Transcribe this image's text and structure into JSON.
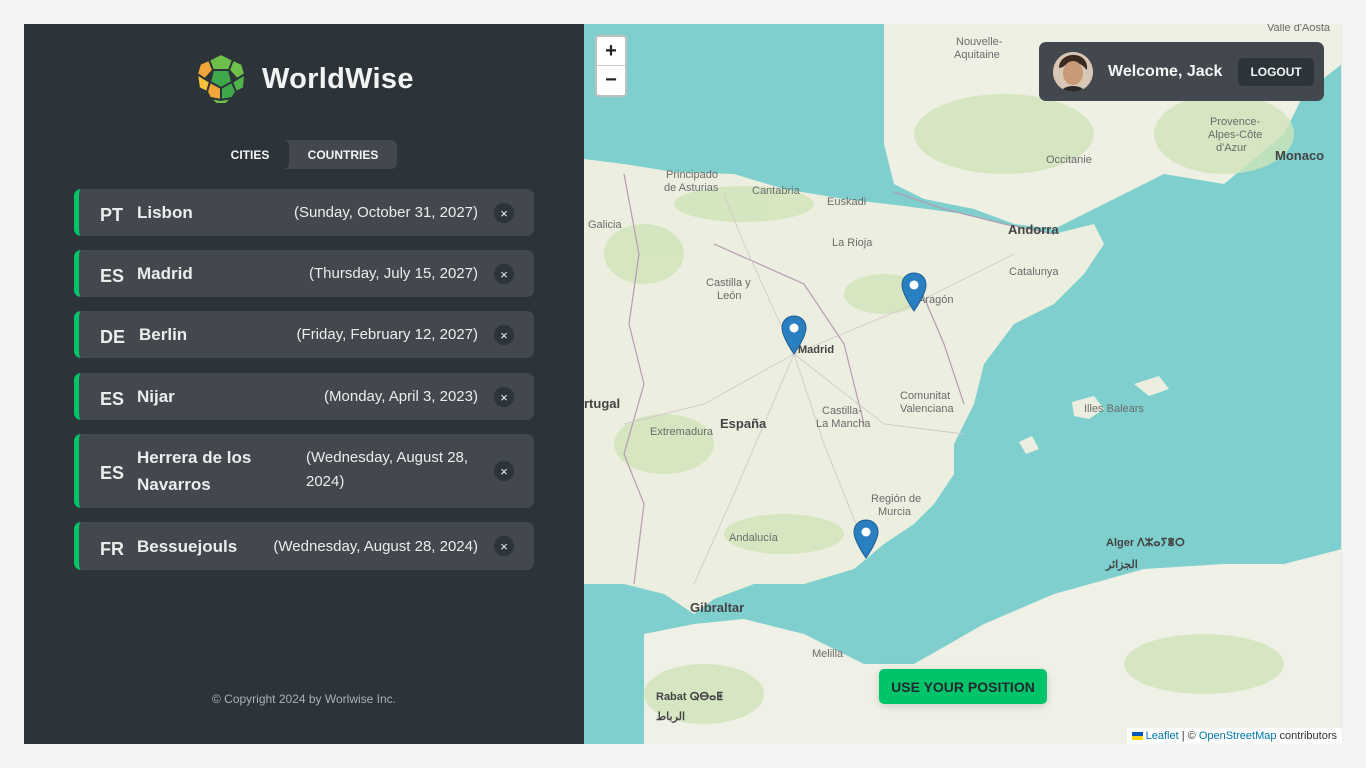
{
  "app": {
    "name": "WorldWise"
  },
  "tabs": {
    "cities": "CITIES",
    "countries": "COUNTRIES"
  },
  "cities": [
    {
      "code": "PT",
      "name": "Lisbon",
      "date": "(Sunday, October 31, 2027)"
    },
    {
      "code": "ES",
      "name": "Madrid",
      "date": "(Thursday, July 15, 2027)"
    },
    {
      "code": "DE",
      "name": "Berlin",
      "date": "(Friday, February 12, 2027)"
    },
    {
      "code": "ES",
      "name": "Nijar",
      "date": "(Monday, April 3, 2023)"
    },
    {
      "code": "ES",
      "name_line1": "Herrera de los",
      "name_line2": "Navarros",
      "date_line1": "(Wednesday, August 28,",
      "date_line2": "2024)"
    },
    {
      "code": "FR",
      "name": "Bessuejouls",
      "date": "(Wednesday, August 28, 2024)"
    }
  ],
  "delete_glyph": "×",
  "footer": "© Copyright 2024 by Worlwise Inc.",
  "map": {
    "zoom_in": "+",
    "zoom_out": "−",
    "labels": {
      "nouvelle": "Nouvelle-",
      "aquitaine": "Aquitaine",
      "valle": "Valle d'Aosta",
      "provence1": "Provence-",
      "provence2": "Alpes-Côte",
      "provence3": "d'Azur",
      "monaco": "Monaco",
      "occitanie": "Occitanie",
      "principado1": "Principado",
      "principado2": "de Asturias",
      "cantabria": "Cantabria",
      "euskadi": "Euskadi",
      "galicia": "Galicia",
      "larioja": "La Rioja",
      "andorra": "Andorra",
      "catalunya": "Catalunya",
      "castilla1": "Castilla y",
      "castilla2": "León",
      "aragon": "Aragón",
      "madrid": "Madrid",
      "portugal": "rtugal",
      "espana": "España",
      "extremadura": "Extremadura",
      "clm1": "Castilla-",
      "clm2": "La Mancha",
      "valenciana1": "Comunitat",
      "valenciana2": "Valenciana",
      "baleares": "Illes Balears",
      "murcia1": "Región de",
      "murcia2": "Murcia",
      "andalucia": "Andalucía",
      "alger": "Alger ⴷⵣⴰⵢⴻⵔ",
      "aljazair": "الجزائر",
      "gibraltar": "Gibraltar",
      "melilla": "Melilla",
      "rabat": "Rabat ⵕⴱⴰⵟ",
      "arribat": "الرباط"
    }
  },
  "user": {
    "welcome": "Welcome, Jack",
    "logout": "LOGOUT"
  },
  "use_position": "USE YOUR POSITION",
  "attribution": {
    "leaflet": "Leaflet",
    "sep": " | © ",
    "osm": "OpenStreetMap",
    "contrib": " contributors"
  },
  "colors": {
    "accent": "#00c46a",
    "sidebar": "#2d3439",
    "card": "#42484d",
    "pin": "#2a7fc0",
    "sea": "#aad3df"
  }
}
